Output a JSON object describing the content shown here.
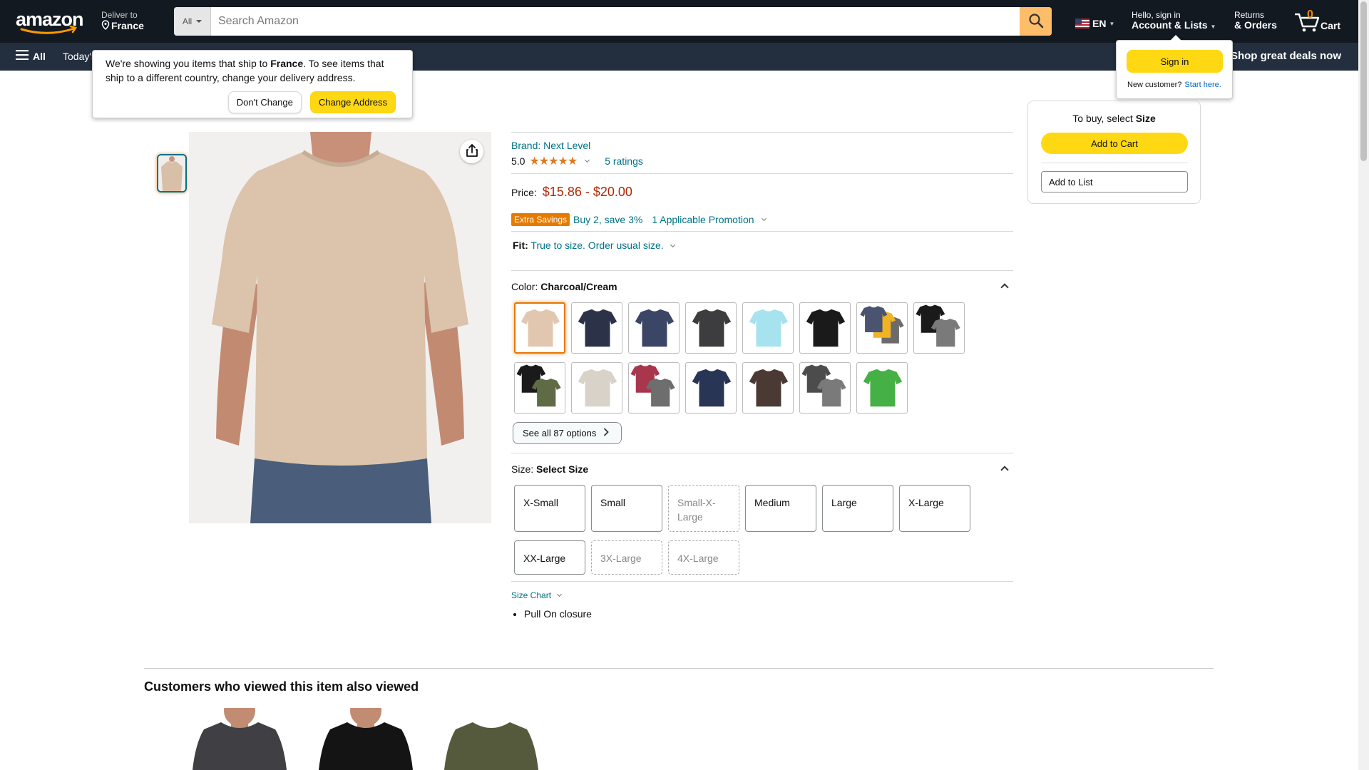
{
  "nav": {
    "deliver_label": "Deliver to",
    "deliver_country": "France",
    "search_category": "All",
    "search_placeholder": "Search Amazon",
    "lang": "EN",
    "account_hello": "Hello, sign in",
    "account_label": "Account & Lists",
    "returns_top": "Returns",
    "returns_bottom": "& Orders",
    "cart_count": "0",
    "cart_label": "Cart",
    "all_label": "All",
    "today_label": "Today's",
    "deals_label": "Shop great deals now"
  },
  "ship_popup": {
    "text_before": "We're showing you items that ship to ",
    "country": "France",
    "text_after": ". To see items that ship to a different country, change your delivery address.",
    "dont_change": "Don't Change",
    "change_address": "Change Address"
  },
  "signin_popup": {
    "button": "Sign in",
    "new_customer": "New customer?",
    "start_here": "Start here."
  },
  "product": {
    "brand": "Brand: Next Level",
    "rating_value": "5.0",
    "stars": "★★★★★",
    "ratings_count": "5 ratings",
    "price_label": "Price:",
    "price_range": "$15.86 - $20.00",
    "promo_badge": "Extra Savings",
    "promo_text": "Buy 2, save 3%",
    "promo_link": "1 Applicable Promotion",
    "fit_label": "Fit:",
    "fit_value": "True to size. Order usual size.",
    "color_label": "Color:",
    "color_value": "Charcoal/Cream",
    "see_all": "See all 87 options",
    "size_label": "Size:",
    "size_value": "Select Size",
    "sizes": [
      {
        "label": "X-Small",
        "available": true
      },
      {
        "label": "Small",
        "available": true
      },
      {
        "label": "Small-X-Large",
        "available": false
      },
      {
        "label": "Medium",
        "available": true
      },
      {
        "label": "Large",
        "available": true
      },
      {
        "label": "X-Large",
        "available": true
      },
      {
        "label": "XX-Large",
        "available": true
      },
      {
        "label": "3X-Large",
        "available": false
      },
      {
        "label": "4X-Large",
        "available": false
      }
    ],
    "size_chart": "Size Chart",
    "bullets": [
      "Pull On closure"
    ]
  },
  "color_swatches": [
    {
      "name": "cream",
      "colors": [
        "#e2c7b0"
      ]
    },
    {
      "name": "midnight-navy",
      "colors": [
        "#2c3348"
      ]
    },
    {
      "name": "indigo",
      "colors": [
        "#3b4566"
      ]
    },
    {
      "name": "charcoal",
      "colors": [
        "#3d3d3f"
      ]
    },
    {
      "name": "light-aqua",
      "colors": [
        "#a7e3ef"
      ]
    },
    {
      "name": "black",
      "colors": [
        "#1a1a1a"
      ]
    },
    {
      "name": "multipack-a",
      "colors": [
        "#4a5470",
        "#f0b323",
        "#6b6b6b"
      ]
    },
    {
      "name": "black-heather-gray",
      "colors": [
        "#1a1a1a",
        "#7a7a7a"
      ]
    },
    {
      "name": "black-military-green",
      "colors": [
        "#1a1a1a",
        "#5e6b45"
      ]
    },
    {
      "name": "sand",
      "colors": [
        "#d8d2c8"
      ]
    },
    {
      "name": "cardinal-gray",
      "colors": [
        "#a8364c",
        "#6e6e6e"
      ]
    },
    {
      "name": "navy",
      "colors": [
        "#283554"
      ]
    },
    {
      "name": "espresso",
      "colors": [
        "#4a3a33"
      ]
    },
    {
      "name": "heavy-metal-gray",
      "colors": [
        "#4c4c4c",
        "#7a7a7a"
      ]
    },
    {
      "name": "kelly-green",
      "colors": [
        "#44b046"
      ]
    }
  ],
  "buybox": {
    "to_buy_prefix": "To buy, select ",
    "to_buy_bold": "Size",
    "add_to_cart": "Add to Cart",
    "add_to_list": "Add to List"
  },
  "also_viewed": {
    "title": "Customers who viewed this item also viewed",
    "items": [
      {
        "color": "#3f3f44"
      },
      {
        "color": "#141414"
      },
      {
        "color": "#555a3c"
      }
    ]
  },
  "colors": {
    "nav_bg": "#131921",
    "subnav_bg": "#232f3e",
    "price": "#B12704",
    "link": "#007185",
    "button_yellow": "#FFD814",
    "search_btn": "#FEBD69"
  }
}
